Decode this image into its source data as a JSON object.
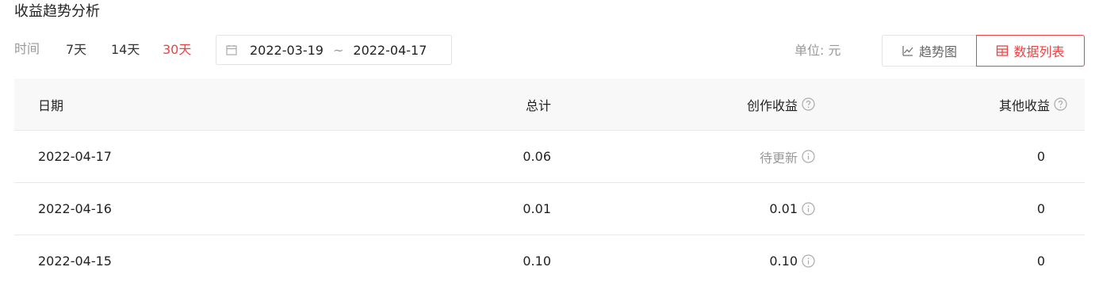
{
  "header": {
    "title": "收益趋势分析"
  },
  "filter": {
    "label": "时间",
    "ranges": [
      {
        "label": "7天",
        "active": false
      },
      {
        "label": "14天",
        "active": false
      },
      {
        "label": "30天",
        "active": true
      }
    ],
    "date_start": "2022-03-19",
    "date_separator": "~",
    "date_end": "2022-04-17",
    "calendar_icon": "calendar-icon"
  },
  "unit": {
    "label": "单位: 元"
  },
  "view_toggle": {
    "trend_label": "趋势图",
    "trend_icon": "line-chart-icon",
    "list_label": "数据列表",
    "list_icon": "table-icon",
    "active": "list"
  },
  "colors": {
    "accent": "#f04142",
    "muted": "#999999",
    "header_bg": "#f8f8f8",
    "border": "#e8e8e8"
  },
  "table": {
    "columns": [
      "日期",
      "总计",
      "创作收益",
      "其他收益"
    ],
    "rows": [
      {
        "date": "2022-04-17",
        "total": "0.06",
        "creation": "待更新",
        "other": "0"
      },
      {
        "date": "2022-04-16",
        "total": "0.01",
        "creation": "0.01",
        "other": "0"
      },
      {
        "date": "2022-04-15",
        "total": "0.10",
        "creation": "0.10",
        "other": "0"
      }
    ]
  }
}
